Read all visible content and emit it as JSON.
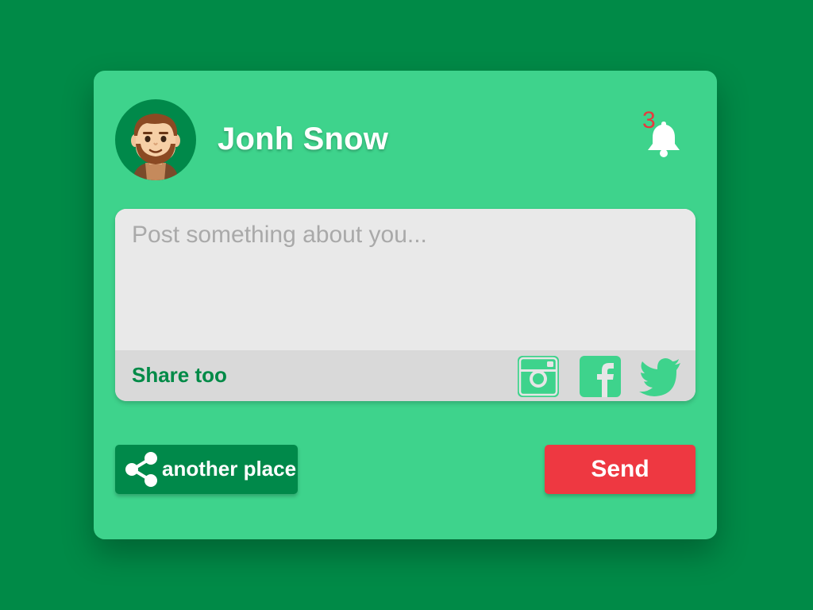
{
  "colors": {
    "page_background": "#008A47",
    "card_background": "#3ED38C",
    "composer_background": "#E9E9E9",
    "share_bar_background": "#D9D9D9",
    "accent_green": "#00894A",
    "send_red": "#EE3841",
    "notification_red": "#E8383E"
  },
  "header": {
    "user_name": "Jonh Snow",
    "avatar_icon": "man-avatar-icon",
    "notifications": {
      "count": "3",
      "icon": "bell-icon"
    }
  },
  "composer": {
    "placeholder": "Post something about you...",
    "value": "",
    "share_label": "Share too",
    "social": [
      {
        "name": "Instagram",
        "icon": "instagram-icon"
      },
      {
        "name": "Facebook",
        "icon": "facebook-icon"
      },
      {
        "name": "Twitter",
        "icon": "twitter-icon"
      }
    ]
  },
  "actions": {
    "share_label": "another place",
    "share_icon": "share-icon",
    "send_label": "Send"
  }
}
